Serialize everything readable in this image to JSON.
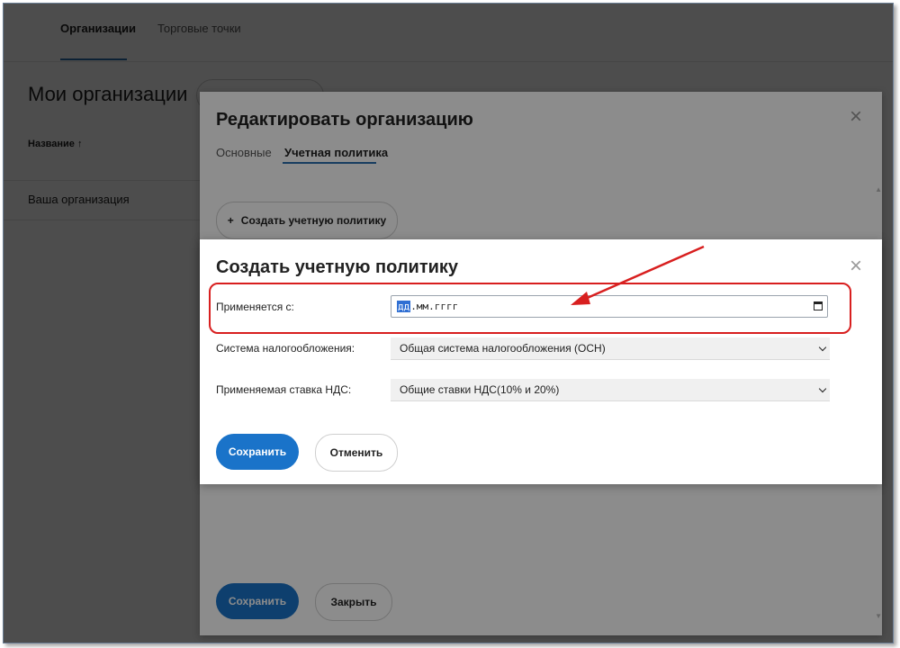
{
  "topnav": {
    "tabs": [
      {
        "label": "Организации",
        "active": true
      },
      {
        "label": "Торговые точки",
        "active": false
      }
    ]
  },
  "page": {
    "title": "Мои организации",
    "table": {
      "column_header": "Название ↑",
      "rows": [
        "Ваша организация"
      ]
    }
  },
  "edit_modal": {
    "title": "Редактировать организацию",
    "tabs": [
      {
        "label": "Основные",
        "active": false
      },
      {
        "label": "Учетная политика",
        "active": true
      }
    ],
    "create_policy_label": "Создать учетную политику",
    "save_label": "Сохранить",
    "close_label": "Закрыть",
    "close_icon": "×"
  },
  "create_modal": {
    "title": "Создать учетную политику",
    "close_icon": "×",
    "fields": {
      "applies_from_label": "Применяется с:",
      "date_segment_day": "дд",
      "date_rest": ".мм.гггг",
      "tax_system_label": "Система налогообложения:",
      "tax_system_value": "Общая система налогообложения (ОСН)",
      "vat_rate_label": "Применяемая ставка НДС:",
      "vat_rate_value": "Общие ставки НДС(10% и 20%)"
    },
    "save_label": "Сохранить",
    "cancel_label": "Отменить"
  },
  "colors": {
    "primary": "#1a73c9",
    "annotation": "#d81f1f",
    "tab_underline": "#2a6fb0"
  }
}
